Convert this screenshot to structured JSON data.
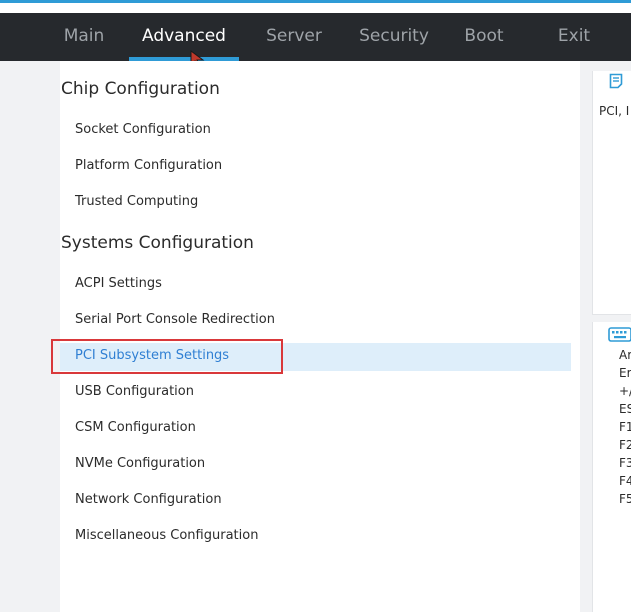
{
  "nav": {
    "tabs": [
      {
        "label": "Main"
      },
      {
        "label": "Advanced"
      },
      {
        "label": "Server"
      },
      {
        "label": "Security"
      },
      {
        "label": "Boot"
      },
      {
        "label": "Exit"
      }
    ],
    "active_tab": "Advanced"
  },
  "menu": {
    "sections": [
      {
        "title": "Chip Configuration",
        "items": [
          "Socket Configuration",
          "Platform Configuration",
          "Trusted Computing"
        ]
      },
      {
        "title": "Systems Configuration",
        "items": [
          "ACPI Settings",
          "Serial Port Console Redirection",
          "PCI Subsystem Settings",
          "USB Configuration",
          "CSM Configuration",
          "NVMe Configuration",
          "Network Configuration",
          "Miscellaneous Configuration"
        ]
      }
    ],
    "selected_item": "PCI Subsystem Settings"
  },
  "help": {
    "text": "PCI, I"
  },
  "keys": {
    "lines": [
      "Ar",
      "Er",
      "+/",
      "ES",
      "F1",
      "F2",
      "F3",
      "F4",
      "F5"
    ]
  },
  "colors": {
    "accent": "#2f9bd6",
    "navbar_bg": "#26292d",
    "highlight_bg": "#deeefa",
    "selection_border": "#d9383a",
    "selected_text": "#2f7fd3"
  },
  "icons": {
    "help": "help-note-icon",
    "keyboard": "keyboard-icon",
    "cursor": "mouse-cursor-icon"
  }
}
